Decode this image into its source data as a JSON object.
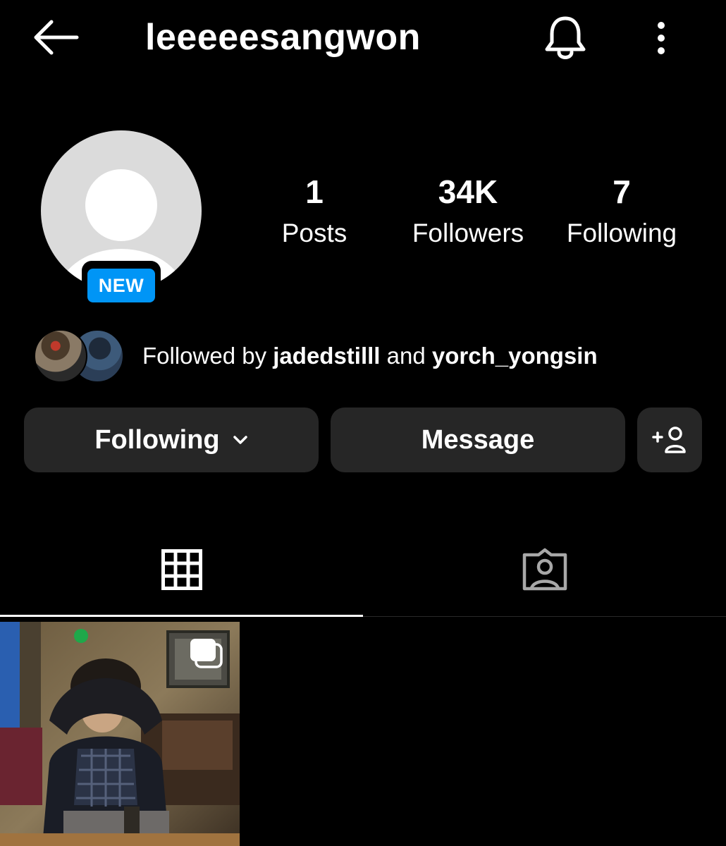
{
  "header": {
    "username": "leeeeesangwon",
    "back_icon": "arrow-left-icon",
    "bell_icon": "bell-icon",
    "more_icon": "more-vertical-icon"
  },
  "profile": {
    "badge": "NEW",
    "stats": {
      "posts": {
        "value": "1",
        "label": "Posts"
      },
      "followers": {
        "value": "34K",
        "label": "Followers"
      },
      "following": {
        "value": "7",
        "label": "Following"
      }
    },
    "followed_by": {
      "prefix": "Followed by",
      "user1": "jadedstilll",
      "conjunction": "and",
      "user2": "yorch_yongsin"
    }
  },
  "actions": {
    "following_label": "Following",
    "message_label": "Message",
    "add_user_icon": "add-user-icon"
  },
  "tabs": [
    {
      "name": "posts-grid",
      "icon": "grid-icon",
      "active": true
    },
    {
      "name": "tagged",
      "icon": "tagged-user-icon",
      "active": false
    }
  ],
  "colors": {
    "background": "#000000",
    "button_bg": "#262626",
    "badge_blue": "#0095f6",
    "avatar_placeholder": "#dbdbdb"
  }
}
